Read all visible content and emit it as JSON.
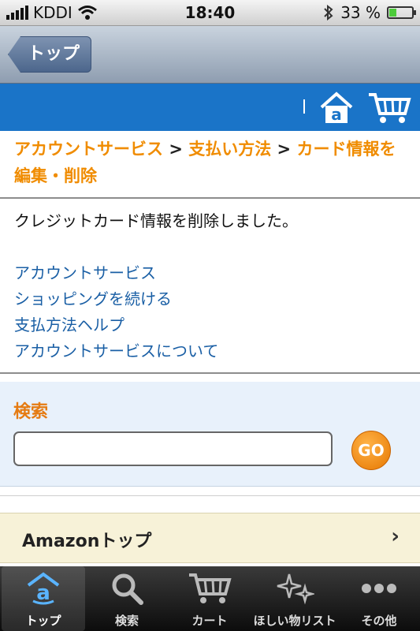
{
  "status": {
    "carrier": "KDDI",
    "time": "18:40",
    "battery": "33 %",
    "battery_level": 0.33
  },
  "nav": {
    "back_label": "トップ"
  },
  "breadcrumb": {
    "items": [
      "アカウントサービス",
      "支払い方法",
      "カード情報を編集・削除"
    ],
    "separator": ">"
  },
  "message": "クレジットカード情報を削除しました。",
  "links": [
    "アカウントサービス",
    "ショッピングを続ける",
    "支払方法ヘルプ",
    "アカウントサービスについて"
  ],
  "search": {
    "title": "検索",
    "placeholder": "",
    "go_label": "GO"
  },
  "amazon_top": {
    "label": "Amazonトップ"
  },
  "tabs": [
    {
      "label": "トップ",
      "icon": "amazon-home-icon"
    },
    {
      "label": "検索",
      "icon": "search-icon"
    },
    {
      "label": "カート",
      "icon": "cart-icon"
    },
    {
      "label": "ほしい物リスト",
      "icon": "wishlist-sparkle-icon"
    },
    {
      "label": "その他",
      "icon": "more-icon"
    }
  ],
  "colors": {
    "header_blue": "#1a74c8",
    "link": "#1a5fa5",
    "breadcrumb": "#f08c00",
    "go": "#e67700"
  }
}
